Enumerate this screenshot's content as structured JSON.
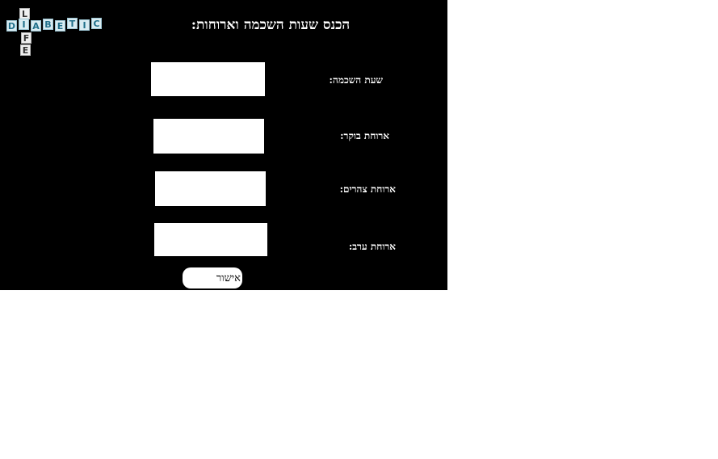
{
  "logo": {
    "horizontal": [
      "D",
      "I",
      "A",
      "B",
      "E",
      "T",
      "I",
      "C"
    ],
    "vertical": [
      "L",
      "I",
      "F",
      "E"
    ]
  },
  "title": "הכנס שעות השכמה וארוחות:",
  "fields": [
    {
      "label": "שעת השכמה:",
      "value": ""
    },
    {
      "label": "ארוחת בוקר:",
      "value": ""
    },
    {
      "label": "ארוחת צהרים:",
      "value": ""
    },
    {
      "label": "ארוחת ערב:",
      "value": ""
    }
  ],
  "submit_label": "אישור",
  "colors": {
    "panel_background": "#000000",
    "page_background": "#ffffff",
    "text": "#ffffff",
    "logo_tile": "#d9ecf2",
    "logo_letter": "#1f6f8a"
  }
}
